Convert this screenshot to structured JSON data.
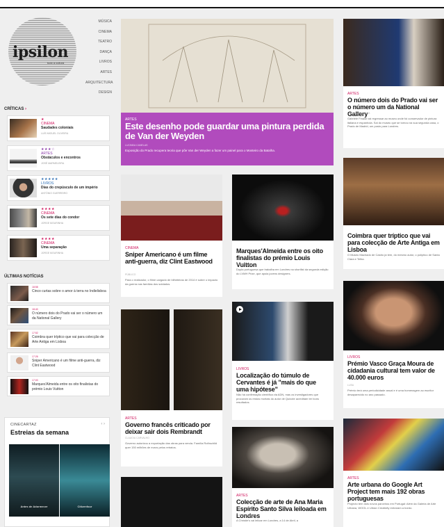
{
  "logo": {
    "name": "ipsilon",
    "tagline": "tudo a cultura"
  },
  "menu": [
    "Música",
    "Cinema",
    "Teatro",
    "Dança",
    "Livros",
    "Artes",
    "Arquitectura",
    "Design"
  ],
  "criticas": {
    "label": "Críticas",
    "arrow": "›",
    "items": [
      {
        "stars": "★",
        "star_color": "#d0185e",
        "category": "Cinema",
        "title": "Saudades coloniais",
        "meta": "LUÍS MIGUEL OLIVEIRA"
      },
      {
        "stars": "★★★☆",
        "star_color": "#8a3aa8",
        "category": "Artes",
        "title": "Obstáculos e encontros",
        "meta": "JOSÉ MARMELEIRA"
      },
      {
        "stars": "★★★★★",
        "star_color": "#2d6fb5",
        "category": "Livros",
        "title": "Dias do crepúsculo de um império",
        "meta": "ANTÓNIO GUERREIRO"
      },
      {
        "stars": "★★★★",
        "star_color": "#d0185e",
        "category": "Cinema",
        "title": "Os sete dias do condor",
        "meta": "JORGE MOURINHA"
      },
      {
        "stars": "★★★★",
        "star_color": "#d0185e",
        "category": "Cinema",
        "title": "Uma separação",
        "meta": "JORGE MOURINHA"
      }
    ]
  },
  "ultimas": {
    "label": "Últimas notícias",
    "items": [
      {
        "time": "18:58",
        "title": "Cinco curtas sobre o amor à terra no Indielisboa"
      },
      {
        "time": "18:40",
        "title": "O número dois do Prado vai ser o número um da National Gallery"
      },
      {
        "time": "17:52",
        "title": "Coimbra quer tríptico que vai para colecção de Arte Antiga em Lisboa"
      },
      {
        "time": "17:26",
        "title": "Sniper Americano é um filme anti-guerra, diz Clint Eastwood"
      },
      {
        "time": "17:00",
        "title": "Marques'Almeida entre os oito finalistas do prémio Louis Vuitton"
      }
    ]
  },
  "cinecartaz": {
    "label": "CINECARTAZ",
    "title": "Estreias da semana",
    "nav": "‹ ›",
    "posters": [
      "Antes de Adormecer",
      "Citizenfour"
    ]
  },
  "hero": {
    "category": "Artes",
    "title": "Este desenho pode guardar uma pintura perdida de Van der Weyden",
    "meta": "LUCINDA CANELAS",
    "excerpt": "Exposição do Prado recupera teoria que põe Van der Weyden a fazer um painel para o Mosteiro da Batalha.",
    "color": "#b14bbd"
  },
  "articles": {
    "prado": {
      "category": "Artes",
      "title": "O número dois do Prado vai ser o número um da National Gallery",
      "meta": "LUCINDA CANELAS",
      "excerpt": "Gabriele Finaldi vai regressar ao museu onde foi conservador de pintura italiana e espanhola. Sai do museu que se tornou na sua segunda casa, o Prado de Madrid, um posto para Londres."
    },
    "coimbra": {
      "category": "",
      "title": "Coimbra quer tríptico que vai para colecção de Arte Antiga em Lisboa",
      "meta": "LUSA",
      "excerpt": "O Museu Machado de Castro já tem, do mesmo autor, o políptico de Santa Clara e Telha."
    },
    "sniper": {
      "category": "Cinema",
      "title": "Sniper Americano é um filme anti-guerra, diz Clint Eastwood",
      "meta": "PÚBLICO",
      "excerpt": "Para o realizador, o filme cargado de bilheteiras de 2014 é sobre o impacto da guerra nas famílias dos soldados."
    },
    "marques": {
      "category": "",
      "title": "Marques'Almeida entre os oito finalistas do prémio Louis Vuitton",
      "meta": "ANA GUERRA",
      "excerpt": "Dupla portuguesa que trabalha em Londres na shortlist da segunda edição do LVMH Prize, que apoia jovens designers."
    },
    "cervantes": {
      "category": "Livros",
      "title": "Localização do túmulo de Cervantes é já \"mais do que uma hipótese\"",
      "meta": "LUCINDA CANELAS",
      "excerpt": "Não há confirmação científica via ADN, mas os investigadores que procuram os restos mortais do autor de Quixote acreditam ter bons resultados."
    },
    "vasco": {
      "category": "Livros",
      "title": "Prémio Vasco Graça Moura de cidadania cultural tem valor de 40.000 euros",
      "meta": "LUSA",
      "excerpt": "Prémio terá uma periodicidade anual e é uma homenagem ao escritor desaparecido no ano passado."
    },
    "rembrandt": {
      "category": "Artes",
      "title": "Governo francês criticado por deixar sair dois Rembrandt",
      "meta": "CLAUDIA CARVALHO",
      "excerpt": "Governo autorizou a exportação das obras para venda. Família Rothschild quer 150 milhões de euros pelos retratos."
    },
    "colecao": {
      "category": "Artes",
      "title": "Colecção de arte de Ana Maria Espírito Santo Silva leiloada em Londres",
      "meta": "PÚBLICO E LUSA",
      "excerpt": "A Christie's vai leiloar em Londres, a 14 de Abril, a"
    },
    "google": {
      "category": "Artes",
      "title": "Arte urbana do Google Art Project tem mais 192 obras portuguesas",
      "meta": "PÚBLICO",
      "excerpt": "Projecto tem dois novos parceiros em Portugal: Além da Galeria de Arte Urbana, WOOL e Urban Creativity entraram a bordo."
    }
  }
}
